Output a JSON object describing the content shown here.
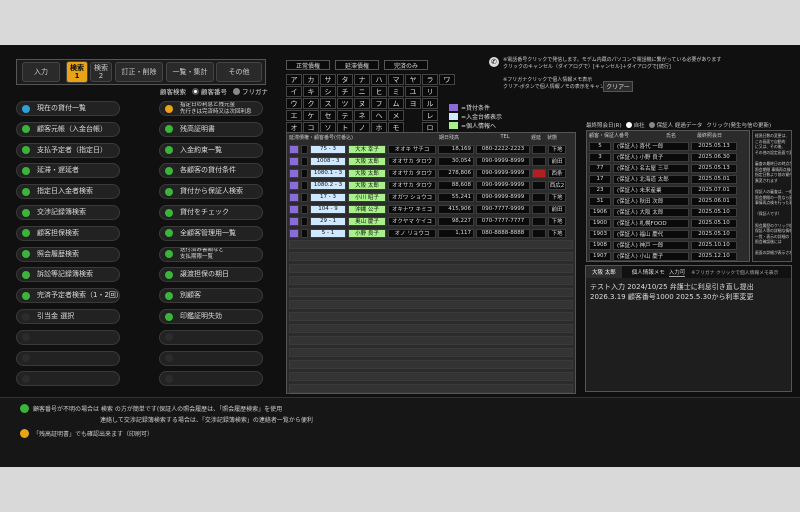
{
  "left_tabs": [
    {
      "label": "入力",
      "active": false
    },
    {
      "label": "検索\n1",
      "active": true
    },
    {
      "label": "検索\n2",
      "active": false
    },
    {
      "label": "訂正・削除",
      "active": false
    },
    {
      "label": "一覧・集計",
      "active": false
    },
    {
      "label": "その他",
      "active": false
    }
  ],
  "customer_search": {
    "label": "顧客検索",
    "option_number": "顧客番号",
    "option_furigana": "フリガナ",
    "selected": "顧客番号"
  },
  "menu_left": [
    {
      "label": "現在の貸付一覧",
      "color": "#2aa3d8"
    },
    {
      "label": "顧客元帳（入金台帳）",
      "color": "#3bb43b"
    },
    {
      "label": "支払予定者（指定日）",
      "color": "#3bb43b"
    },
    {
      "label": "延滞・遅延者",
      "color": "#3bb43b"
    },
    {
      "label": "指定日入金者検索",
      "color": "#3bb43b"
    },
    {
      "label": "交渉記録簿検索",
      "color": "#3bb43b"
    },
    {
      "label": "顧客担保検索",
      "color": "#3bb43b"
    },
    {
      "label": "照会履歴検索",
      "color": "#3bb43b"
    },
    {
      "label": "訴訟等記録簿検索",
      "color": "#3bb43b"
    },
    {
      "label": "完済予定者検索（1・2回）",
      "color": "#3bb43b"
    },
    {
      "label": "引当金 選択",
      "color": "#2c2c2c"
    },
    {
      "label": "",
      "color": ""
    },
    {
      "label": "",
      "color": ""
    },
    {
      "label": "",
      "color": ""
    }
  ],
  "menu_right": [
    {
      "label": "指定日の利息と残元金\n先行きは完済時又は次回利息",
      "color": "#e8a317"
    },
    {
      "label": "残高証明書",
      "color": "#3bb43b"
    },
    {
      "label": "入金約束一覧",
      "color": "#3bb43b"
    },
    {
      "label": "各顧客の貸付条件",
      "color": "#3bb43b"
    },
    {
      "label": "貸付から保証人検索",
      "color": "#3bb43b"
    },
    {
      "label": "貸付をチェック",
      "color": "#3bb43b"
    },
    {
      "label": "全顧客管理用一覧",
      "color": "#3bb43b"
    },
    {
      "label": "送付済み書類など\n支払期限一覧",
      "color": "#3bb43b"
    },
    {
      "label": "譲渡担保の期日",
      "color": "#3bb43b"
    },
    {
      "label": "別顧客",
      "color": "#3bb43b"
    },
    {
      "label": "印鑑証明失効",
      "color": "#3bb43b"
    },
    {
      "label": "",
      "color": ""
    },
    {
      "label": "",
      "color": ""
    },
    {
      "label": "",
      "color": ""
    }
  ],
  "header_buttons": [
    "正常債権",
    "延滞債権",
    "完済のみ"
  ],
  "kana_grid": [
    [
      "ア",
      "カ",
      "サ",
      "タ",
      "ナ",
      "ハ",
      "マ",
      "ヤ",
      "ラ",
      "ワ"
    ],
    [
      "イ",
      "キ",
      "シ",
      "チ",
      "ニ",
      "ヒ",
      "ミ",
      "ユ",
      "リ",
      ""
    ],
    [
      "ウ",
      "ク",
      "ス",
      "ツ",
      "ヌ",
      "フ",
      "ム",
      "ヨ",
      "ル",
      ""
    ],
    [
      "エ",
      "ケ",
      "セ",
      "テ",
      "ネ",
      "ヘ",
      "メ",
      "",
      "レ",
      ""
    ],
    [
      "オ",
      "コ",
      "ソ",
      "ト",
      "ノ",
      "ホ",
      "モ",
      "",
      "ロ",
      ""
    ]
  ],
  "legend": [
    {
      "label": "=貸付条件",
      "color": "#8a6bd8"
    },
    {
      "label": "=入金台帳表示",
      "color": "#cfe8ff"
    },
    {
      "label": "=個人情報へ",
      "color": "#a8f08a"
    }
  ],
  "help_text": {
    "line1": "※電話番号クリックで発信します。モデム内蔵のパソコンで電話機に繋がっている必要があります",
    "line2": "クリックのキャンセル（ダイアログで）[キャンセル]＋ダイアログで[続行]",
    "line3": "※フリガナクリックで個人情報メモ表示",
    "line4": "クリア-ボタンで個人情報ノモの表示をキャンセル",
    "clear_button": "クリアー"
  },
  "loan_table": {
    "header": "延滞債権・顧客番号(付番込)",
    "col_amount": "期日残高",
    "col_tel": "TEL",
    "col_status": "遅延",
    "col_office": "状態",
    "rows": [
      {
        "id": "75 - 3",
        "name": "大木 幸子",
        "kana": "オオキ サチコ",
        "amount": "18,169",
        "tel": "080-2222-2223",
        "status": "",
        "office": "下地"
      },
      {
        "id": "1008 - 3",
        "name": "大阪 太郎",
        "kana": "オオサカ タロウ",
        "amount": "30,054",
        "tel": "090-9999-8999",
        "status": "",
        "office": "前田"
      },
      {
        "id": "1080.1 - 3",
        "name": "大阪 太郎",
        "kana": "オオサカ タロウ",
        "amount": "278,806",
        "tel": "090-9999-9999",
        "status": "red",
        "office": "西条"
      },
      {
        "id": "1080.2 - 3",
        "name": "大阪 太郎",
        "kana": "オオサカ タロウ",
        "amount": "88,608",
        "tel": "090-9999-9999",
        "status": "",
        "office": "西広2"
      },
      {
        "id": "17 - 3",
        "name": "小川 昭子",
        "kana": "オガワ ショウコ",
        "amount": "55,241",
        "tel": "090-9999-8999",
        "status": "",
        "office": "下地"
      },
      {
        "id": "104 - 9",
        "name": "沖縄 公子",
        "kana": "オキナワ キミコ",
        "amount": "415,906",
        "tel": "090-7777-9999",
        "status": "",
        "office": "前田"
      },
      {
        "id": "29 - 1",
        "name": "奥山 慶子",
        "kana": "オクヤマ ケイコ",
        "amount": "98,227",
        "tel": "070-7777-7777",
        "status": "",
        "office": "下地"
      },
      {
        "id": "5 - 1",
        "name": "小野 良子",
        "kana": "オノ リョウコ",
        "amount": "1,117",
        "tel": "080-8888-8888",
        "status": "",
        "office": "下地"
      }
    ]
  },
  "contract_table": {
    "header": "最終照会日(R)",
    "option1": "自社",
    "option2": "保証人 経過データ",
    "note": "クリック(発生与信の更新)",
    "col1": "顧客・保証人番号",
    "col2": "氏名",
    "col3": "最終照会日",
    "rows": [
      {
        "no": "5",
        "name": "(保証人) 喜代 一郎",
        "date": "2025.05.13"
      },
      {
        "no": "3",
        "name": "(保証人) 小野 良子",
        "date": "2025.06.30"
      },
      {
        "no": "77",
        "name": "(保証人) 名古屋 三平",
        "date": "2025.05.13"
      },
      {
        "no": "17",
        "name": "(保証人) 北海道 太郎",
        "date": "2025.05.01"
      },
      {
        "no": "23",
        "name": "(保証人) 未来産業",
        "date": "2025.07.01"
      },
      {
        "no": "31",
        "name": "(保証人) 秋田 次郎",
        "date": "2025.06.01"
      },
      {
        "no": "1906",
        "name": "(保証人) 大阪 太郎",
        "date": "2025.05.10"
      },
      {
        "no": "1900",
        "name": "(保証人) 札幌FOOD",
        "date": "2025.05.10"
      },
      {
        "no": "1903",
        "name": "(保証人) 福山 慶代",
        "date": "2025.05.10"
      },
      {
        "no": "1908",
        "name": "(保証人) 神戸 一郎",
        "date": "2025.10.10"
      },
      {
        "no": "1907",
        "name": "(保証人) 小山 慶子",
        "date": "2025.12.10"
      }
    ]
  },
  "side_notes": [
    "経過日数の変更は、",
    "この画面で自動的",
    "に又は、その後、",
    "その他の設定画面で変更可",
    "",
    "審査の最終日の時点から",
    "照会期間 事情再点検の",
    "指定日数より前の貸付は",
    "異変されます",
    "",
    "保証人の審査は、一般一覧より",
    "照会期間の一覧なら異変済",
    "事情再点検を行った事由を",
    "",
    "（保証人です）",
    "",
    "照会履歴のクリック後の画面",
    "保証人等の詳細な情報により",
    "一覧・表示の詳細の",
    "照会確認後には",
    "",
    "画面の詳細が表示されます"
  ],
  "memo_panel": {
    "tab_active": "大阪 太郎",
    "tab_label": "個人情報メモ",
    "input_btn": "入力可",
    "hint": "※フリガナ クリックで個人情報メモ表示",
    "line1": "テスト入力 2024/10/25 弁護士に利息引き直し提出",
    "line2": "2026.3.19 顧客番号1000 2025.5.30から利率変更"
  },
  "footer": {
    "note1": "顧客番号が不明の場合は 検索 の方が簡単です(保証人の照会履歴は、「照会履歴検索」を使用",
    "note2": "連絡して交渉記録簿検索する場合は、「交渉記録簿検索」の連絡者一覧から便利",
    "note3": "「残高証明書」でも確認出来ます（印刷可）"
  }
}
